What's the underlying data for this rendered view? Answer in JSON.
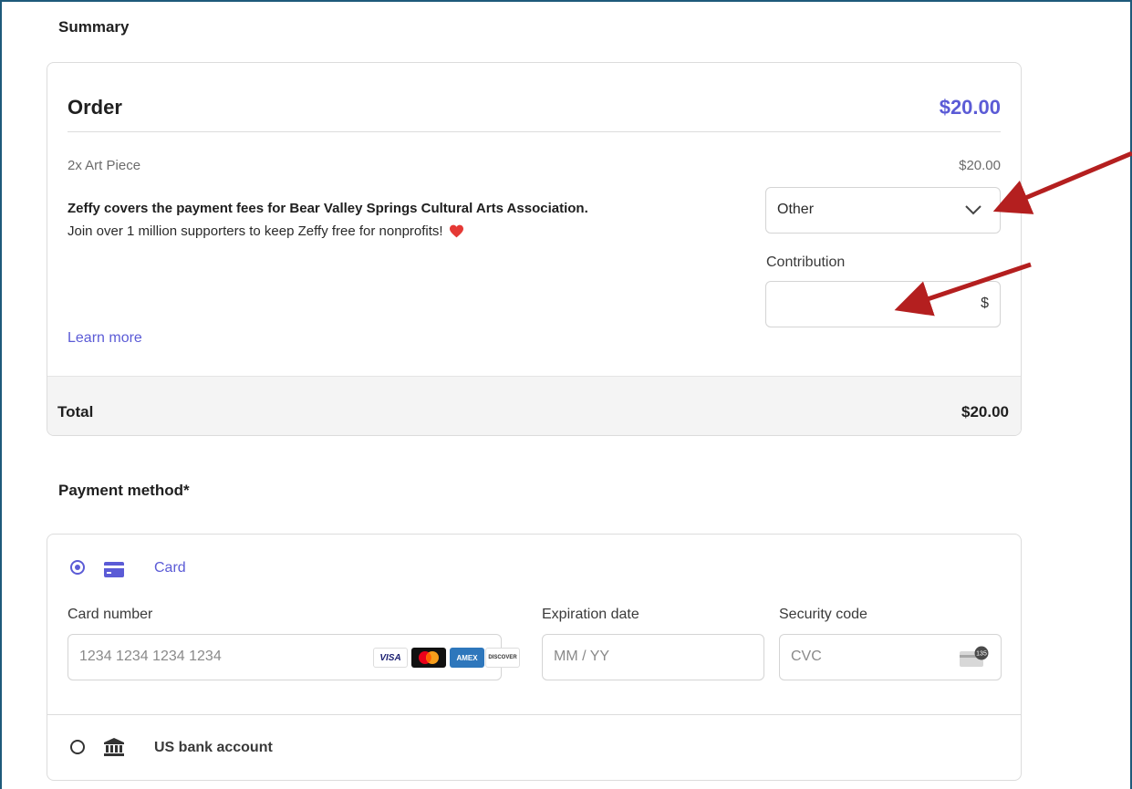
{
  "summary": {
    "title": "Summary",
    "order_title": "Order",
    "order_amount": "$20.00",
    "item_label": "2x Art Piece",
    "item_amount": "$20.00",
    "fee_notice": "Zeffy covers the payment fees for Bear Valley Springs Cultural Arts Association.",
    "support_text": "Join over 1 million supporters to keep Zeffy free for nonprofits!",
    "heart_icon": "heart-icon",
    "tip_select_value": "Other",
    "contribution_label": "Contribution",
    "contribution_value": "",
    "currency_symbol": "$",
    "learn_more": "Learn more",
    "total_label": "Total",
    "total_amount": "$20.00"
  },
  "payment": {
    "title": "Payment method*",
    "methods": [
      {
        "label": "Card",
        "selected": true,
        "icon": "card-icon"
      },
      {
        "label": "US bank account",
        "selected": false,
        "icon": "bank-icon"
      }
    ],
    "card_number_label": "Card number",
    "card_number_placeholder": "1234 1234 1234 1234",
    "expiration_label": "Expiration date",
    "expiration_placeholder": "MM / YY",
    "security_label": "Security code",
    "security_placeholder": "CVC",
    "brands": [
      "VISA",
      "MC",
      "AMEX",
      "DISCOVER"
    ],
    "cvc_badge": "135"
  },
  "colors": {
    "accent": "#5b5bd6",
    "annotation_arrow": "#b41f1f",
    "heart": "#e53935"
  }
}
